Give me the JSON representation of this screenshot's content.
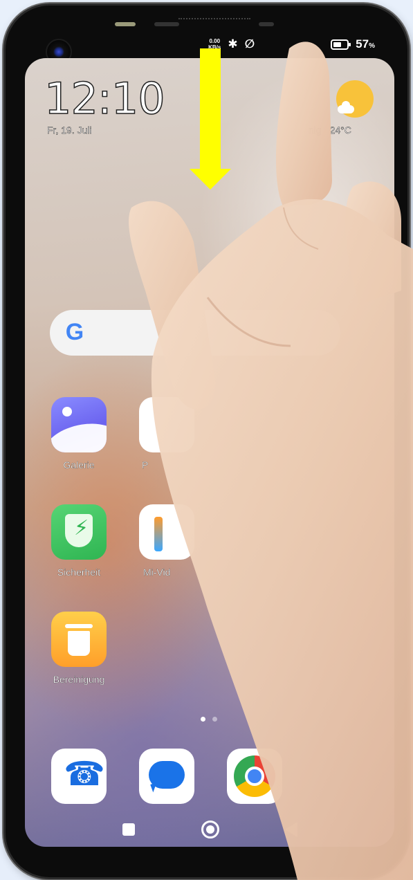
{
  "status_bar": {
    "net_speed_value": "0.00",
    "net_speed_unit": "KB/s",
    "battery_percent": "57",
    "battery_unit": "%"
  },
  "lock_widget": {
    "time": "12:10",
    "date": "Fr, 19. Juli",
    "weather_text": "nig 24°C"
  },
  "search_bar": {
    "logo_letter": "G"
  },
  "apps": [
    {
      "label": "Galerie",
      "icon": "gallery-icon"
    },
    {
      "label": "P",
      "icon": "photos-icon"
    },
    {
      "label": "Sicherheit",
      "icon": "security-shield-icon"
    },
    {
      "label": "Mi-Vid",
      "icon": "mi-video-icon"
    },
    {
      "label": "Bereinigung",
      "icon": "cleaner-trash-icon"
    }
  ],
  "dock": [
    {
      "icon": "phone-icon"
    },
    {
      "icon": "messages-icon"
    },
    {
      "icon": "chrome-icon"
    }
  ],
  "page_indicator": {
    "pages": 2,
    "current": 1
  },
  "colors": {
    "arrow": "#ffff00",
    "security_green": "#2fb552",
    "gallery_purple": "#6b63ef",
    "cleaner_orange": "#ff9f2a"
  }
}
